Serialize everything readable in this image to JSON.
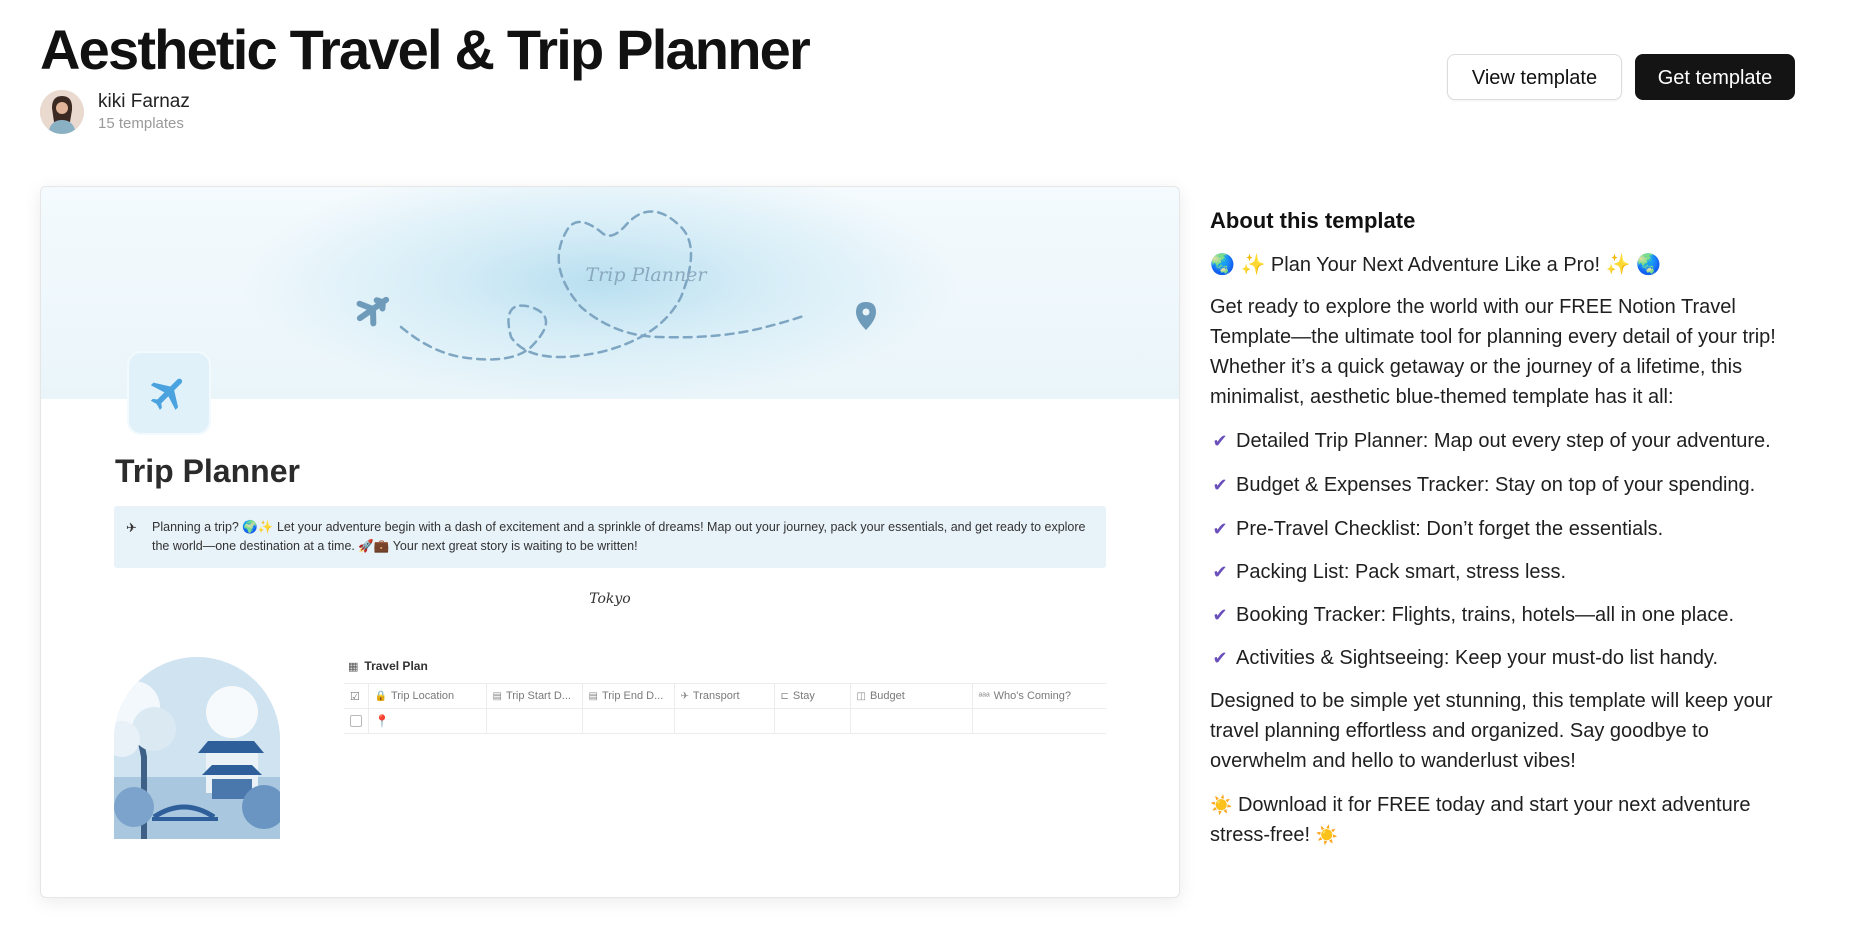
{
  "header": {
    "title": "Aesthetic Travel & Trip Planner",
    "author_name": "kiki Farnaz",
    "author_templates": "15 templates",
    "view_button": "View template",
    "get_button": "Get template"
  },
  "preview": {
    "cover_text": "Trip Planner",
    "page_title": "Trip Planner",
    "callout_text": "Planning a trip? 🌍✨ Let your adventure begin with a dash of excitement and a sprinkle of dreams! Map out your journey, pack your essentials, and get ready to explore the world—one destination at a time. 🚀💼 Your next great story is waiting to be written!",
    "city": "Tokyo",
    "table": {
      "title": "Travel Plan",
      "columns": [
        "Trip Location",
        "Trip Start D...",
        "Trip End D...",
        "Transport",
        "Stay",
        "Budget",
        "Who's Coming?"
      ]
    }
  },
  "about": {
    "heading": "About this template",
    "intro_line": "🌏 ✨ Plan Your Next Adventure Like a Pro! ✨ 🌏",
    "paragraph": "Get ready to explore the world with our FREE Notion Travel Template—the ultimate tool for planning every detail of your trip! Whether it’s a quick getaway or the journey of a lifetime, this minimalist, aesthetic blue-themed template has it all:",
    "features": [
      "Detailed Trip Planner: Map out every step of your adventure.",
      "Budget & Expenses Tracker: Stay on top of your spending.",
      "Pre-Travel Checklist: Don’t forget the essentials.",
      "Packing List: Pack smart, stress less.",
      "Booking Tracker: Flights, trains, hotels—all in one place.",
      "Activities & Sightseeing: Keep your must-do list handy."
    ],
    "closing": "Designed to be simple yet stunning, this template will keep your travel planning effortless and organized. Say goodbye to overwhelm and hello to wanderlust vibes!",
    "cta": "Download it for FREE today and start your next adventure stress-free!"
  },
  "colors": {
    "accent_check": "#6b4fbb",
    "primary_button_bg": "#141414",
    "cover_blue": "#b9dff0"
  }
}
